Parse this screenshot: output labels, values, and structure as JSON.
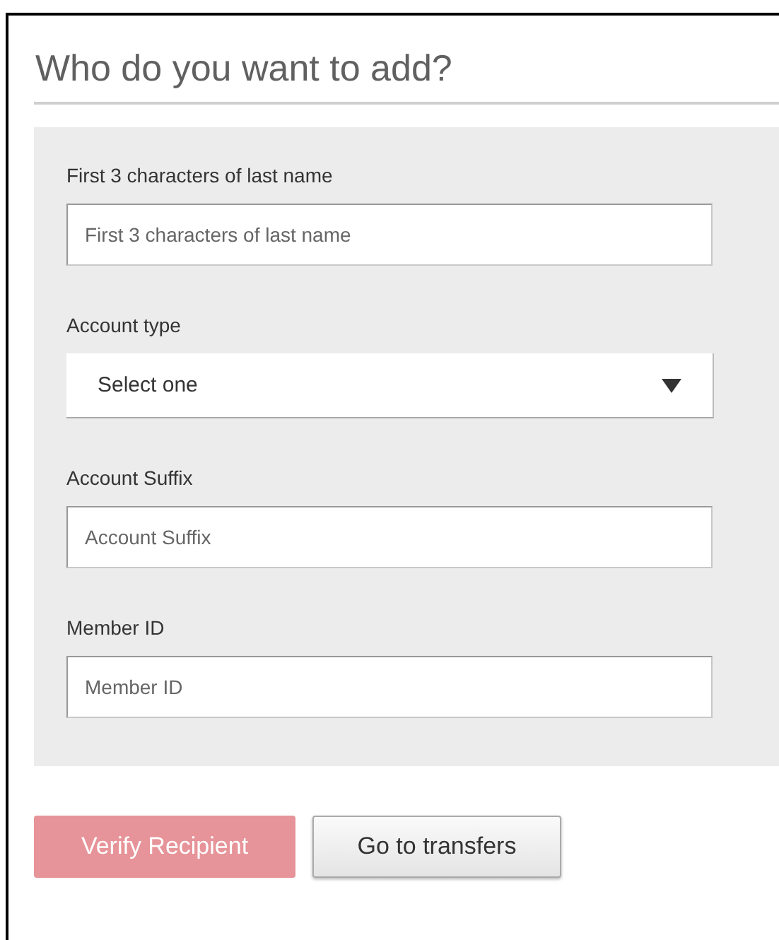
{
  "title": "Who do you want to add?",
  "fields": [
    {
      "kind": "text",
      "label": "First 3 characters of last name",
      "placeholder": "First 3 characters of last name"
    },
    {
      "kind": "select",
      "label": "Account type",
      "value": "Select one"
    },
    {
      "kind": "text",
      "label": "Account Suffix",
      "placeholder": "Account Suffix"
    },
    {
      "kind": "text",
      "label": "Member ID",
      "placeholder": "Member ID"
    }
  ],
  "buttons": [
    {
      "kind": "primary",
      "label": "Verify Recipient",
      "disabled": true
    },
    {
      "kind": "secondary",
      "label": "Go to transfers",
      "disabled": false
    }
  ]
}
